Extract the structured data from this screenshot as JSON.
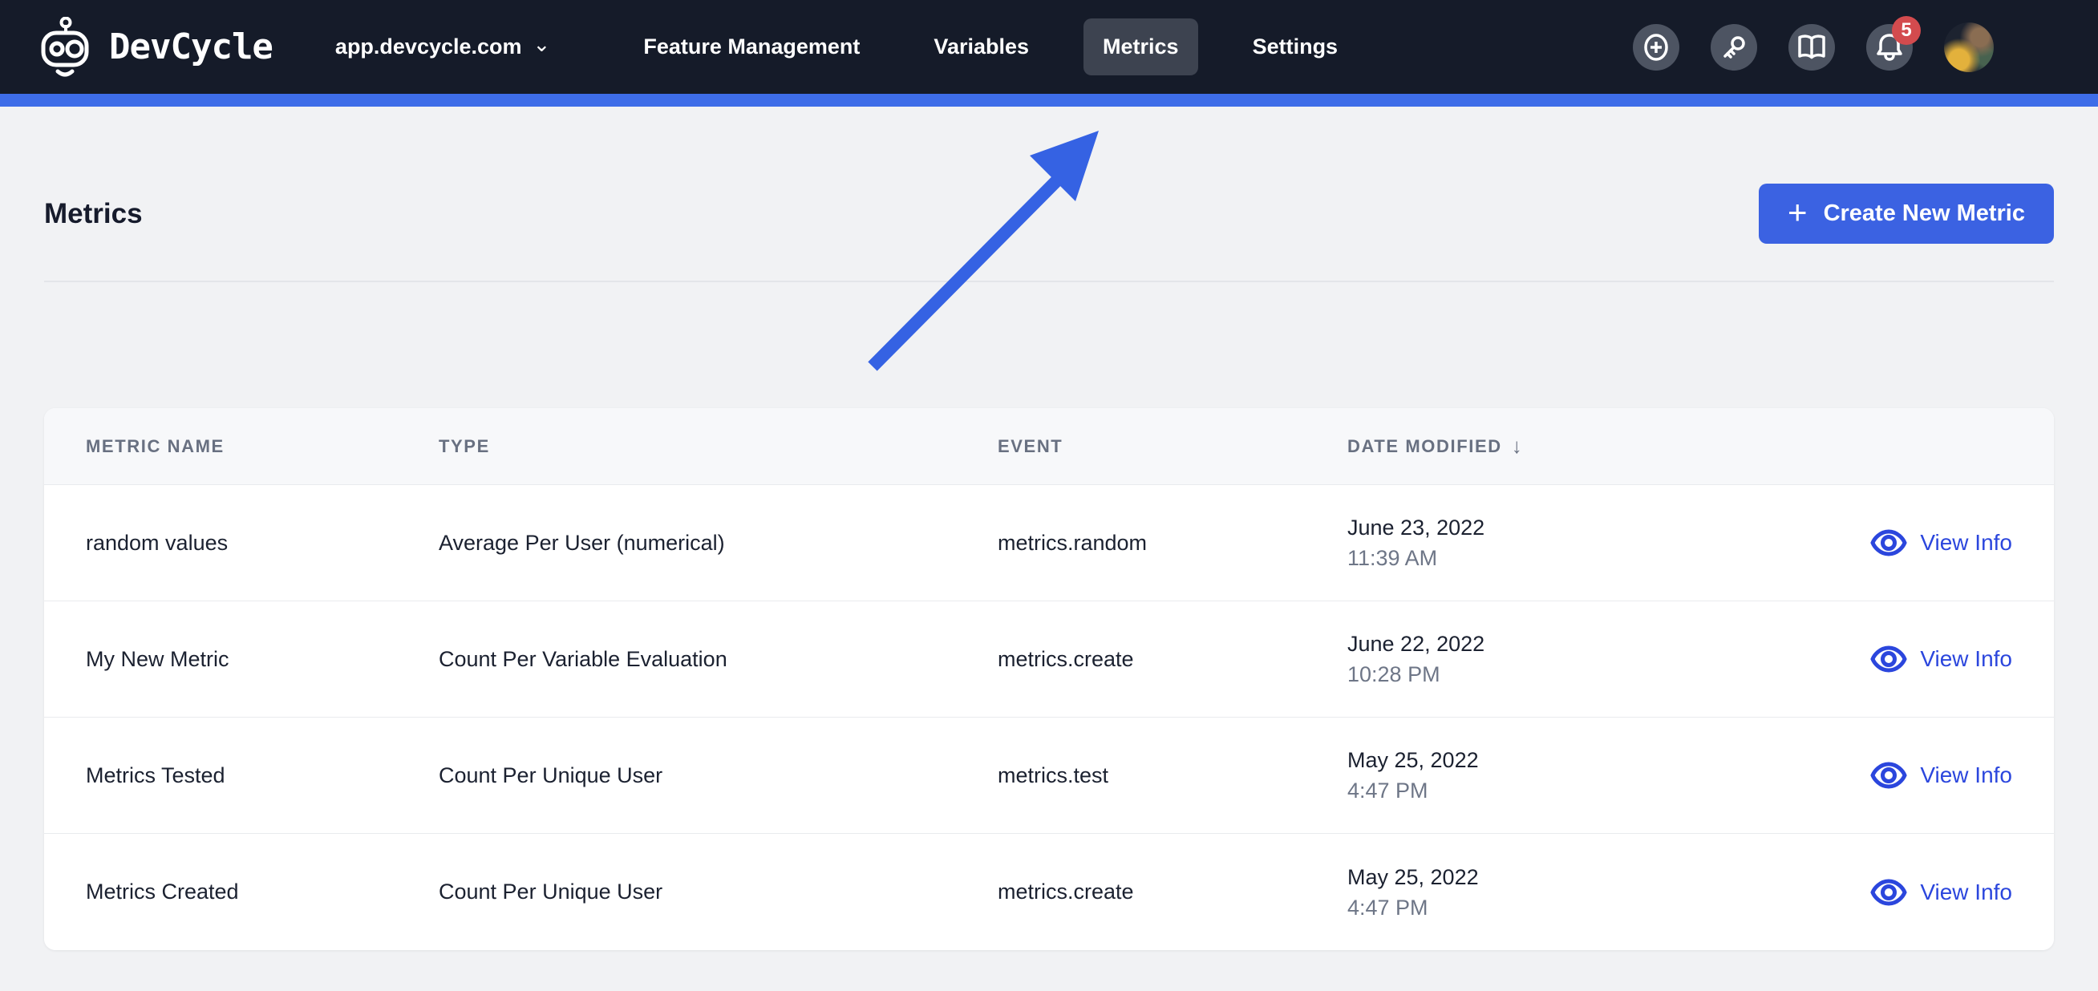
{
  "navbar": {
    "brand": "DevCycle",
    "org_selector": "app.devcycle.com",
    "items": [
      {
        "label": "Feature Management",
        "active": false
      },
      {
        "label": "Variables",
        "active": false
      },
      {
        "label": "Metrics",
        "active": true
      },
      {
        "label": "Settings",
        "active": false
      }
    ],
    "notification_count": "5",
    "icon_buttons": [
      "plus-circle-icon",
      "key-icon",
      "book-icon",
      "bell-icon"
    ]
  },
  "icons": {
    "chevron_down": "⌄",
    "plus": "+",
    "sort_desc": "↓"
  },
  "page": {
    "title": "Metrics",
    "create_button_label": "Create New Metric"
  },
  "table": {
    "columns": [
      "Metric Name",
      "Type",
      "Event",
      "Date Modified"
    ],
    "sort_column": "Date Modified",
    "sort_direction": "descending",
    "rows": [
      {
        "name": "random values",
        "type": "Average Per User (numerical)",
        "event": "metrics.random",
        "date": "June 23, 2022",
        "time": "11:39 AM",
        "action": "View Info"
      },
      {
        "name": "My New Metric",
        "type": "Count Per Variable Evaluation",
        "event": "metrics.create",
        "date": "June 22, 2022",
        "time": "10:28 PM",
        "action": "View Info"
      },
      {
        "name": "Metrics Tested",
        "type": "Count Per Unique User",
        "event": "metrics.test",
        "date": "May 25, 2022",
        "time": "4:47 PM",
        "action": "View Info"
      },
      {
        "name": "Metrics Created",
        "type": "Count Per Unique User",
        "event": "metrics.create",
        "date": "May 25, 2022",
        "time": "4:47 PM",
        "action": "View Info"
      }
    ]
  },
  "annotation": {
    "type": "arrow",
    "points_to": "Metrics nav tab",
    "color": "#3562e3"
  },
  "colors": {
    "navbar_bg": "#151b29",
    "active_tab_bg": "#3d4350",
    "accent_bar": "#3e6de8",
    "page_bg": "#f1f2f4",
    "primary_button": "#3b62e2",
    "link_blue": "#2b46dd",
    "badge_red": "#d34b4e"
  }
}
